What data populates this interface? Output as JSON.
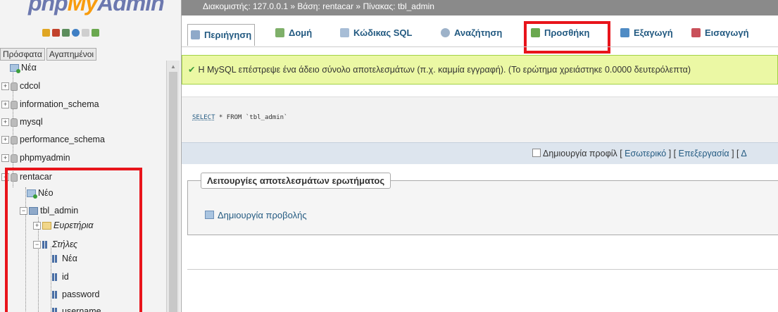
{
  "logo": {
    "php": "php",
    "my": "My",
    "admin": "Admin"
  },
  "left": {
    "tabs": [
      "Πρόσφατα",
      "Αγαπημένοι"
    ],
    "tree": {
      "new_root": "Νέα",
      "dbs": [
        "cdcol",
        "information_schema",
        "mysql",
        "performance_schema",
        "phpmyadmin",
        "rentacar"
      ],
      "rentacar_new": "Νέο",
      "table": "tbl_admin",
      "indexes": "Ευρετήρια",
      "columns": "Στήλες",
      "columns_new": "Νέα",
      "cols": [
        "id",
        "password",
        "username"
      ]
    }
  },
  "topbar": {
    "breadcrumb": "Διακομιστής: 127.0.0.1 » Βάση: rentacar » Πίνακας: tbl_admin"
  },
  "tabs": [
    "Περιήγηση",
    "Δομή",
    "Κώδικας SQL",
    "Αναζήτηση",
    "Προσθήκη",
    "Εξαγωγή",
    "Εισαγωγή"
  ],
  "message": "Η MySQL επέστρεψε ένα άδειο σύνολο αποτελεσμάτων (π.χ. καμμία εγγραφή). (Το ερώτημα χρειάστηκε 0.0000 δευτερόλεπτα)",
  "sql": {
    "select": "SELECT",
    "rest": " * FROM `tbl_admin`"
  },
  "profiling": {
    "label": "Δημιουργία προφίλ",
    "inline": "Εσωτερικό",
    "edit": "Επεξεργασία",
    "extra": "Δ"
  },
  "query_ops": {
    "legend": "Λειτουργίες αποτελεσμάτων ερωτήματος",
    "create_view": "Δημιουργία προβολής"
  },
  "colors": {
    "highlight": "#e8141b",
    "link": "#235a81",
    "success_bg": "#ebf8a4"
  }
}
